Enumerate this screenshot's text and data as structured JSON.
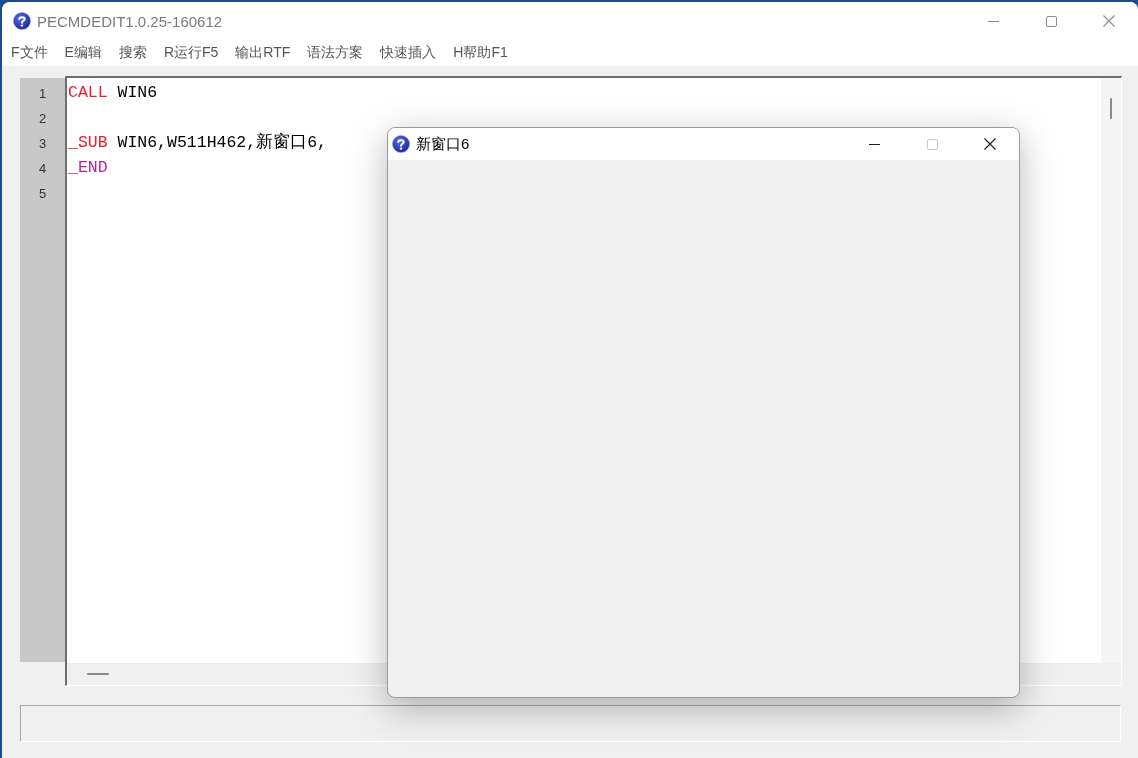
{
  "window": {
    "title": "PECMDEDIT1.0.25-160612",
    "active": false,
    "controls": [
      {
        "kind": "minimize",
        "disabled": false
      },
      {
        "kind": "maximize",
        "disabled": false
      },
      {
        "kind": "close",
        "disabled": false
      }
    ]
  },
  "menu": [
    "F文件",
    "E编辑",
    "搜索",
    "R运行F5",
    "输出RTF",
    "语法方案",
    "快速插入",
    "H帮助F1"
  ],
  "editor": {
    "lines": [
      {
        "number": "1",
        "tokens": [
          {
            "text": "CALL",
            "color": "#e8202a"
          },
          {
            "text": " WIN6",
            "color": "#000000"
          }
        ]
      },
      {
        "number": "2"
      },
      {
        "number": "3",
        "tokens": [
          {
            "text": "_SUB",
            "color": "#e8202a"
          },
          {
            "text": " WIN6,W511H462,新窗口6,",
            "color": "#000000"
          }
        ]
      },
      {
        "number": "4",
        "tokens": [
          {
            "text": "_END",
            "color": "#c0209a"
          }
        ]
      },
      {
        "number": "5"
      }
    ]
  },
  "dialog": {
    "title": "新窗口6",
    "active": true,
    "controls": [
      {
        "kind": "minimize",
        "disabled": false
      },
      {
        "kind": "maximize",
        "disabled": true
      },
      {
        "kind": "close",
        "disabled": false
      }
    ]
  }
}
